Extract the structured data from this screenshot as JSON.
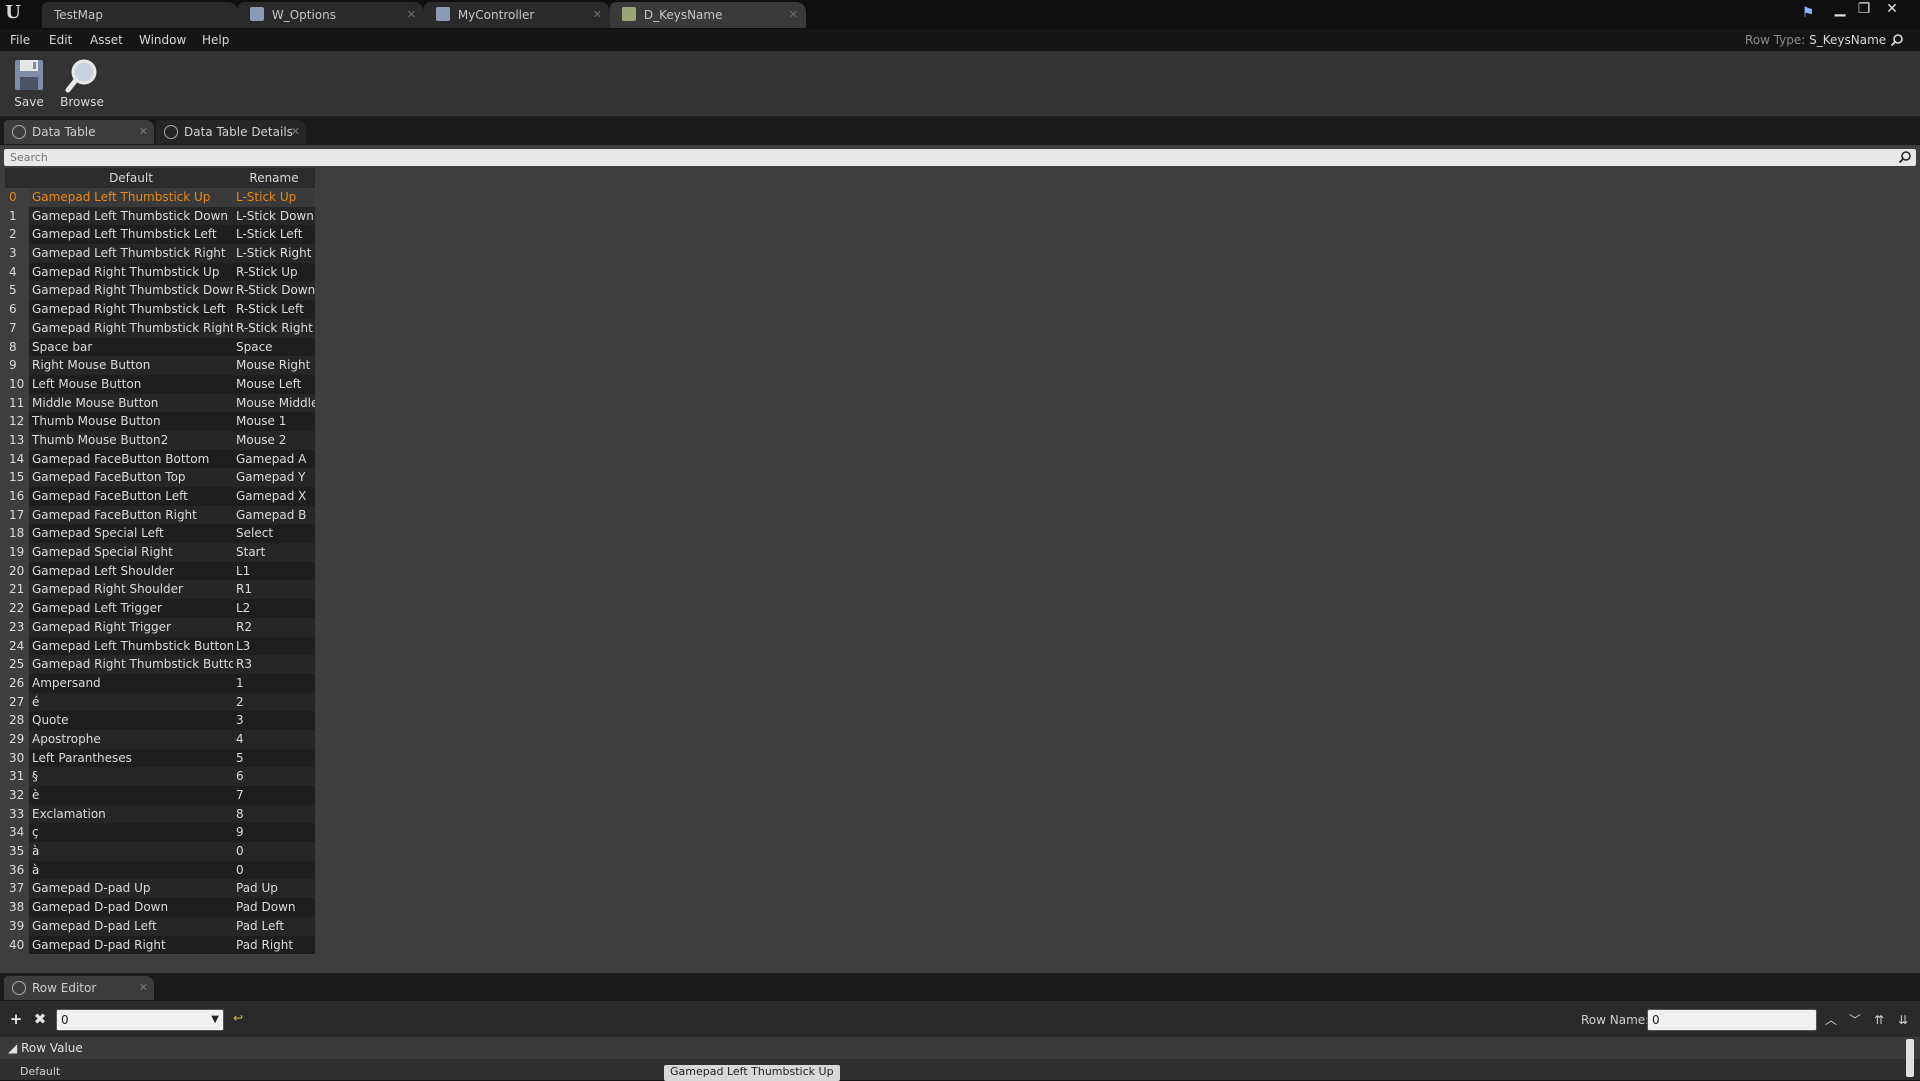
{
  "app": {
    "logo_text": "U",
    "row_type_label": "Row Type:",
    "row_type_value": "S_KeysName"
  },
  "doc_tabs": [
    {
      "label": "TestMap"
    },
    {
      "label": "W_Options"
    },
    {
      "label": "MyController"
    },
    {
      "label": "D_KeysName"
    }
  ],
  "menu": [
    "File",
    "Edit",
    "Asset",
    "Window",
    "Help"
  ],
  "toolbar": {
    "save_label": "Save",
    "browse_label": "Browse"
  },
  "panel_tabs": {
    "data_table": "Data Table",
    "details": "Data Table Details"
  },
  "search": {
    "placeholder": "Search"
  },
  "table": {
    "headers": {
      "default": "Default",
      "rename": "Rename"
    },
    "selected_index": 0,
    "rows": [
      {
        "idx": "0",
        "default": "Gamepad Left Thumbstick Up",
        "rename": "L-Stick Up"
      },
      {
        "idx": "1",
        "default": "Gamepad Left Thumbstick Down",
        "rename": "L-Stick Down"
      },
      {
        "idx": "2",
        "default": "Gamepad Left Thumbstick Left",
        "rename": "L-Stick Left"
      },
      {
        "idx": "3",
        "default": "Gamepad Left Thumbstick Right",
        "rename": "L-Stick Right"
      },
      {
        "idx": "4",
        "default": "Gamepad Right Thumbstick Up",
        "rename": "R-Stick Up"
      },
      {
        "idx": "5",
        "default": "Gamepad Right Thumbstick Down",
        "rename": "R-Stick Down"
      },
      {
        "idx": "6",
        "default": "Gamepad Right Thumbstick Left",
        "rename": "R-Stick Left"
      },
      {
        "idx": "7",
        "default": "Gamepad Right Thumbstick Right",
        "rename": "R-Stick Right"
      },
      {
        "idx": "8",
        "default": "Space bar",
        "rename": "Space"
      },
      {
        "idx": "9",
        "default": "Right Mouse Button",
        "rename": "Mouse Right"
      },
      {
        "idx": "10",
        "default": "Left Mouse Button",
        "rename": "Mouse Left"
      },
      {
        "idx": "11",
        "default": "Middle Mouse Button",
        "rename": "Mouse Middle"
      },
      {
        "idx": "12",
        "default": "Thumb Mouse Button",
        "rename": "Mouse 1"
      },
      {
        "idx": "13",
        "default": "Thumb Mouse Button2",
        "rename": "Mouse 2"
      },
      {
        "idx": "14",
        "default": "Gamepad FaceButton Bottom",
        "rename": "Gamepad A"
      },
      {
        "idx": "15",
        "default": "Gamepad FaceButton Top",
        "rename": "Gamepad Y"
      },
      {
        "idx": "16",
        "default": "Gamepad FaceButton Left",
        "rename": "Gamepad X"
      },
      {
        "idx": "17",
        "default": "Gamepad FaceButton Right",
        "rename": "Gamepad B"
      },
      {
        "idx": "18",
        "default": "Gamepad Special Left",
        "rename": "Select"
      },
      {
        "idx": "19",
        "default": "Gamepad Special Right",
        "rename": "Start"
      },
      {
        "idx": "20",
        "default": "Gamepad Left Shoulder",
        "rename": "L1"
      },
      {
        "idx": "21",
        "default": "Gamepad Right Shoulder",
        "rename": "R1"
      },
      {
        "idx": "22",
        "default": "Gamepad Left Trigger",
        "rename": "L2"
      },
      {
        "idx": "23",
        "default": "Gamepad Right Trigger",
        "rename": "R2"
      },
      {
        "idx": "24",
        "default": "Gamepad Left Thumbstick Button",
        "rename": "L3"
      },
      {
        "idx": "25",
        "default": "Gamepad Right Thumbstick Button",
        "rename": "R3"
      },
      {
        "idx": "26",
        "default": "Ampersand",
        "rename": "1"
      },
      {
        "idx": "27",
        "default": "é",
        "rename": "2"
      },
      {
        "idx": "28",
        "default": "Quote",
        "rename": "3"
      },
      {
        "idx": "29",
        "default": "Apostrophe",
        "rename": "4"
      },
      {
        "idx": "30",
        "default": "Left Parantheses",
        "rename": "5"
      },
      {
        "idx": "31",
        "default": "§",
        "rename": "6"
      },
      {
        "idx": "32",
        "default": "è",
        "rename": "7"
      },
      {
        "idx": "33",
        "default": "Exclamation",
        "rename": "8"
      },
      {
        "idx": "34",
        "default": "ç",
        "rename": "9"
      },
      {
        "idx": "35",
        "default": "à",
        "rename": "0"
      },
      {
        "idx": "36",
        "default": "à",
        "rename": "0"
      },
      {
        "idx": "37",
        "default": "Gamepad D-pad Up",
        "rename": "Pad Up"
      },
      {
        "idx": "38",
        "default": "Gamepad D-pad Down",
        "rename": "Pad Down"
      },
      {
        "idx": "39",
        "default": "Gamepad D-pad Left",
        "rename": "Pad Left"
      },
      {
        "idx": "40",
        "default": "Gamepad D-pad Right",
        "rename": "Pad Right"
      }
    ]
  },
  "row_editor": {
    "tab_label": "Row Editor",
    "combo_value": "0",
    "row_name_label": "Row Name:",
    "row_name_value": "0",
    "row_value_header": "Row Value",
    "field_name": "Default",
    "field_value": "Gamepad Left Thumbstick Up"
  },
  "colors": {
    "accent": "#e8891c",
    "background": "#3e3e3e",
    "table_dark": "#1e1e1e"
  }
}
